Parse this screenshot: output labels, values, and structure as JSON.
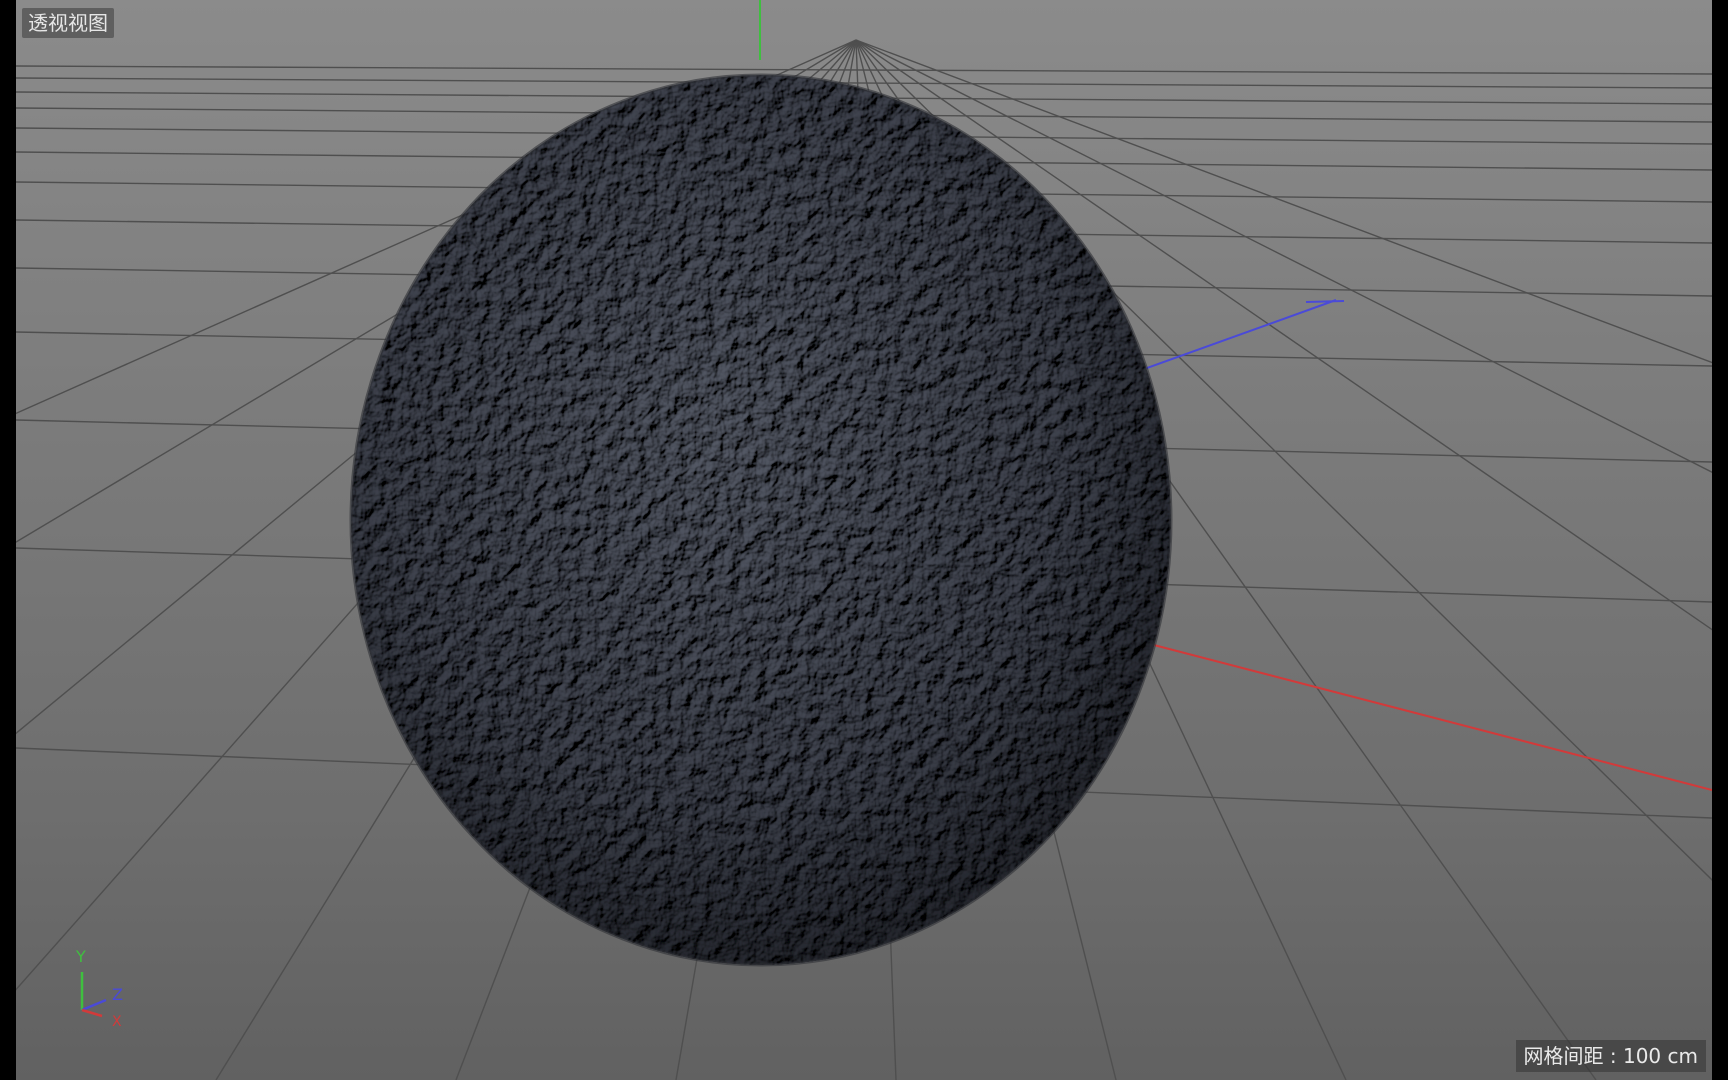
{
  "viewport": {
    "view_name": "透视视图",
    "grid_spacing_label": "网格间距 : 100 cm"
  },
  "axis_gizmo": {
    "y_label": "Y",
    "z_label": "Z",
    "x_label": "X",
    "colors": {
      "x": "#d23a3a",
      "y": "#3fbf3f",
      "z": "#4a4ad8"
    }
  },
  "scene": {
    "object": "noise-displaced-sphere",
    "grid_color": "#4a4a4a",
    "sphere_color": "#5d6068"
  }
}
